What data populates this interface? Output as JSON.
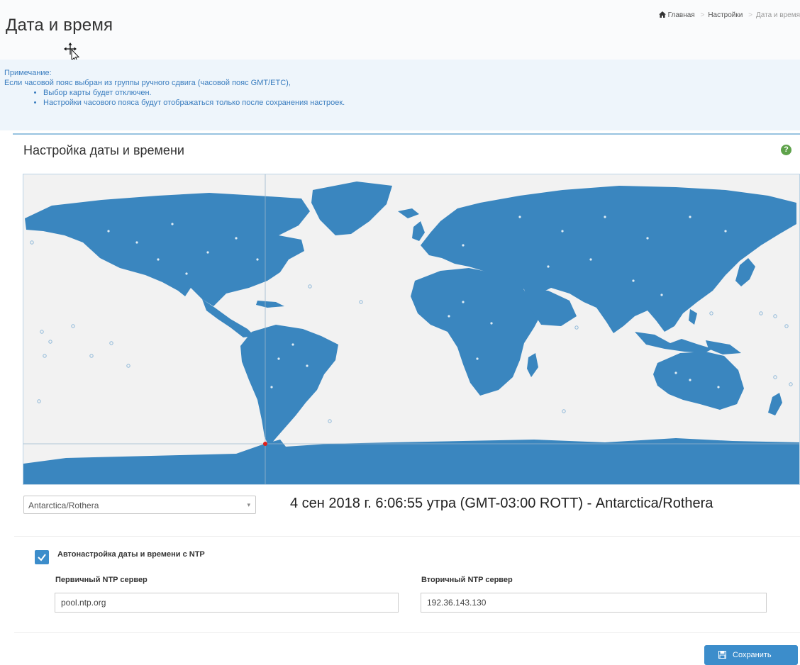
{
  "header": {
    "title": "Дата и время",
    "breadcrumb": {
      "home": "Главная",
      "settings": "Настройки",
      "current": "Дата и время"
    }
  },
  "note": {
    "title": "Примечание:",
    "text": "Если часовой пояс выбран из группы ручного сдвига (часовой пояс GMT/ETC),",
    "bullets": [
      "Выбор карты будет отключен.",
      "Настройки часового пояса будут отображаться только после сохранения настроек."
    ]
  },
  "panel": {
    "title": "Настройка даты и времени",
    "help_icon": "question-circle-icon"
  },
  "timezone": {
    "selected": "Antarctica/Rothera",
    "clock": "4 сен 2018 г. 6:06:55 утра (GMT-03:00 ROTT)  -  Antarctica/Rothera"
  },
  "ntp": {
    "checkbox_label": "Автонастройка даты и времени с NTP",
    "checked": true,
    "primary_label": "Первичный NTP сервер",
    "primary_value": "pool.ntp.org",
    "secondary_label": "Вторичный NTP сервер",
    "secondary_value": "192.36.143.130"
  },
  "save_label": "Сохранить",
  "colors": {
    "accent": "#3c8dcb",
    "land": "#3a86bf",
    "ocean": "#f2f2f2",
    "note_bg": "#eef5fb",
    "note_text": "#3a7dbf",
    "help": "#5ea24a",
    "marker": "#e0201b"
  }
}
